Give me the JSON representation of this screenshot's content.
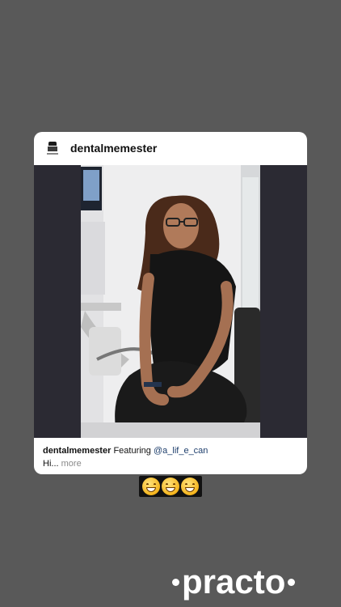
{
  "post": {
    "username": "dentalmemester",
    "caption_user": "dentalmemester",
    "caption_prefix": "Featuring",
    "caption_mention": "@a_lif_e_can",
    "caption_text": "Hi...",
    "caption_more": "more"
  },
  "sticker": {
    "emojis": [
      "grinning-face-with-smiling-eyes",
      "grinning-face-with-smiling-eyes",
      "grinning-face-with-smiling-eyes"
    ]
  },
  "brand": {
    "name": "practo"
  },
  "colors": {
    "background": "#595959",
    "card": "#ffffff",
    "media_background": "#2b2a33",
    "mention": "#1c3d6b"
  }
}
